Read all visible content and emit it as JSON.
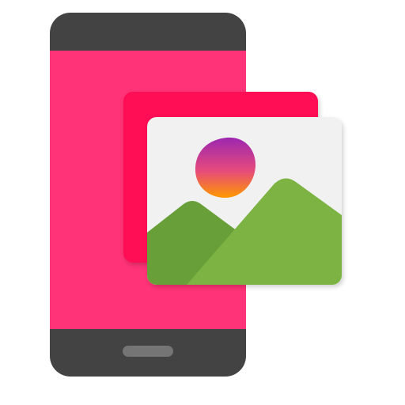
{
  "icon": {
    "name": "phone-gallery-app-icon",
    "parts": [
      "phone-icon",
      "picture-icon",
      "sun-icon",
      "mountain-icon"
    ]
  },
  "colors": {
    "phone_frame": "#434343",
    "phone_screen": "#ff3377",
    "home_button": "#757575",
    "back_card": "#ff0a55",
    "picture_bg": "#f1f1f1",
    "picture_shadow": "#c9c9c9",
    "mountain_back": "#689f38",
    "mountain_front": "#7cb342",
    "sun_gradient_top": "#9c27b0",
    "sun_gradient_mid": "#e64a7c",
    "sun_gradient_bottom": "#ff9800"
  }
}
